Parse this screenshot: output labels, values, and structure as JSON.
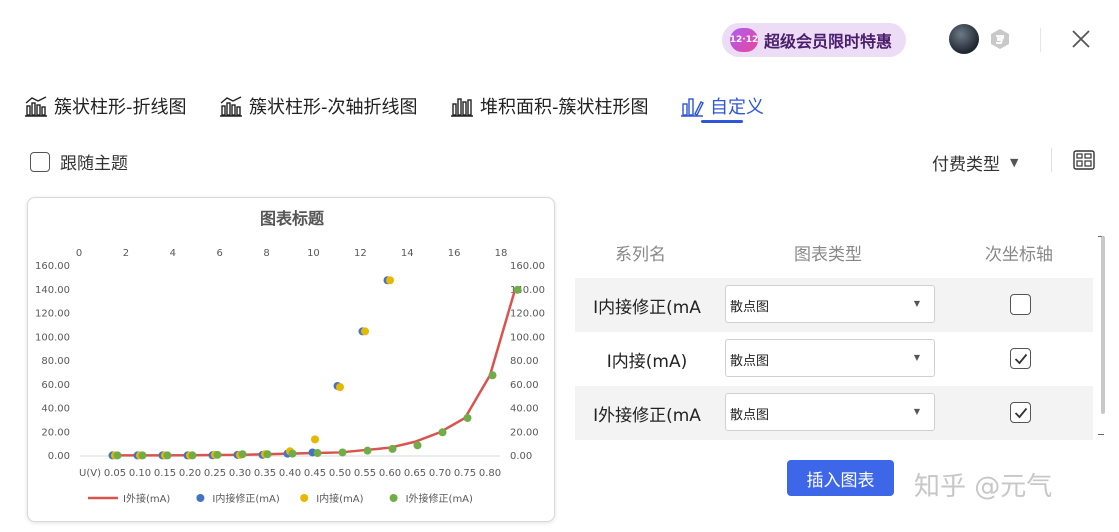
{
  "header": {
    "vip_badge_icon": "12·12",
    "vip_badge_text": "超级会员限时特惠",
    "avatar": "user-avatar",
    "close_icon": "close-icon"
  },
  "tabs": [
    {
      "label": "簇状柱形-折线图",
      "icon": "combo-chart-icon"
    },
    {
      "label": "簇状柱形-次轴折线图",
      "icon": "combo-chart-icon"
    },
    {
      "label": "堆积面积-簇状柱形图",
      "icon": "bar-chart-icon"
    },
    {
      "label": "自定义",
      "icon": "custom-chart-icon",
      "active": true
    }
  ],
  "options": {
    "follow_theme_label": "跟随主题",
    "pay_type_label": "付费类型"
  },
  "series_table": {
    "headers": [
      "系列名",
      "图表类型",
      "次坐标轴"
    ],
    "rows": [
      {
        "name": "I内接修正(mA",
        "chart_type": "散点图",
        "secondary_axis": false
      },
      {
        "name": "I内接(mA)",
        "chart_type": "散点图",
        "secondary_axis": true
      },
      {
        "name": "I外接修正(mA",
        "chart_type": "散点图",
        "secondary_axis": true
      }
    ]
  },
  "insert_button_label": "插入图表",
  "watermark": "知乎 @元气",
  "colors": {
    "accent": "#3d66e8",
    "line": "#d9534f",
    "blue": "#4472c4",
    "gold": "#e6b800",
    "green": "#70ad47"
  },
  "chart_data": {
    "type": "scatter",
    "title": "图表标题",
    "x_categories": [
      "U(V)",
      "0.05",
      "0.10",
      "0.15",
      "0.20",
      "0.25",
      "0.30",
      "0.35",
      "0.40",
      "0.45",
      "0.50",
      "0.55",
      "0.60",
      "0.65",
      "0.70",
      "0.75",
      "0.80"
    ],
    "y_ticks": [
      "0.00",
      "20.00",
      "40.00",
      "60.00",
      "80.00",
      "100.00",
      "120.00",
      "140.00",
      "160.00"
    ],
    "ylim": [
      0,
      160
    ],
    "top_x_ticks": [
      "0",
      "2",
      "4",
      "6",
      "8",
      "10",
      "12",
      "14",
      "16",
      "18"
    ],
    "top_xlim": [
      0,
      18
    ],
    "series": [
      {
        "name": "I外接(mA)",
        "kind": "line",
        "axis": "primary",
        "color": "#d9534f",
        "points": [
          [
            1,
            0.5
          ],
          [
            2,
            0.5
          ],
          [
            3,
            0.5
          ],
          [
            4,
            0.6
          ],
          [
            5,
            0.8
          ],
          [
            6,
            1
          ],
          [
            7,
            1.5
          ],
          [
            8,
            2
          ],
          [
            9,
            2.5
          ],
          [
            10,
            3
          ],
          [
            11,
            5
          ],
          [
            12,
            7
          ],
          [
            13,
            12
          ],
          [
            14,
            20
          ],
          [
            15,
            32
          ],
          [
            16,
            68
          ],
          [
            17,
            140
          ]
        ]
      },
      {
        "name": "I内接修正(mA)",
        "kind": "scatter",
        "axis": "primary",
        "color": "#4472c4",
        "points": [
          [
            1,
            0.5
          ],
          [
            2,
            0.5
          ],
          [
            3,
            0.5
          ],
          [
            4,
            0.5
          ],
          [
            5,
            0.6
          ],
          [
            6,
            1
          ],
          [
            7,
            1
          ],
          [
            8,
            2
          ],
          [
            9,
            3
          ],
          [
            10,
            59
          ],
          [
            11,
            105
          ],
          [
            12,
            148
          ]
        ]
      },
      {
        "name": "I内接(mA)",
        "kind": "scatter",
        "axis": "secondary",
        "color": "#e6b800",
        "points": [
          [
            1,
            0.5
          ],
          [
            2,
            0.5
          ],
          [
            3,
            0.5
          ],
          [
            4,
            0.5
          ],
          [
            5,
            1
          ],
          [
            6,
            1
          ],
          [
            7,
            1.5
          ],
          [
            8,
            4
          ],
          [
            9,
            14
          ],
          [
            10,
            58
          ],
          [
            11,
            105
          ],
          [
            12,
            148
          ]
        ]
      },
      {
        "name": "I外接修正(mA)",
        "kind": "scatter",
        "axis": "secondary",
        "color": "#70ad47",
        "points": [
          [
            1,
            0.5
          ],
          [
            2,
            0.5
          ],
          [
            3,
            0.5
          ],
          [
            4,
            0.5
          ],
          [
            5,
            1
          ],
          [
            6,
            1.5
          ],
          [
            7,
            1.5
          ],
          [
            8,
            2
          ],
          [
            9,
            2.5
          ],
          [
            10,
            3
          ],
          [
            11,
            4.5
          ],
          [
            12,
            6
          ],
          [
            13,
            9
          ],
          [
            14,
            20
          ],
          [
            15,
            32
          ],
          [
            16,
            68
          ],
          [
            17,
            140
          ]
        ]
      }
    ],
    "legend": [
      "I外接(mA)",
      "I内接修正(mA)",
      "I内接(mA)",
      "I外接修正(mA)"
    ],
    "legend_position": "bottom"
  }
}
